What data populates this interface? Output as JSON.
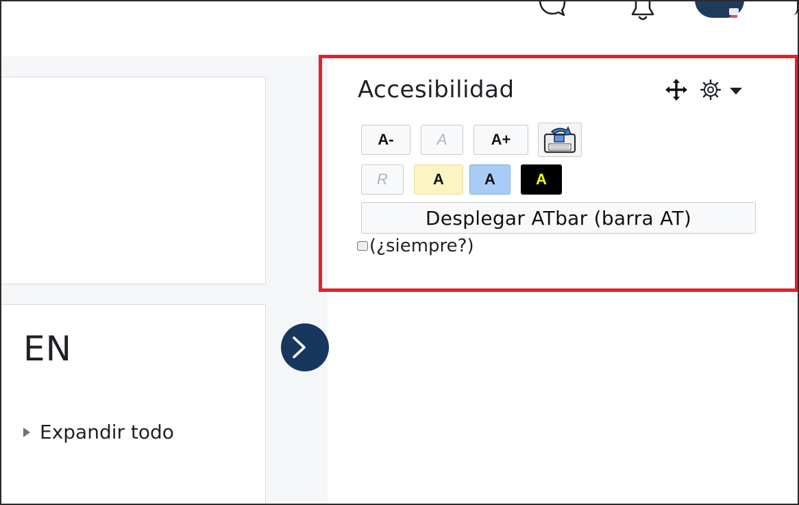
{
  "navbar": {
    "icons": [
      "message-icon",
      "bell-icon",
      "user-avatar",
      "overflow-icon"
    ]
  },
  "course": {
    "title": "EN",
    "expand_all_label": "Expandir todo"
  },
  "accessibility_block": {
    "title": "Accesibilidad",
    "controls": [
      "move-icon",
      "gear-icon",
      "caret-down-icon"
    ],
    "text_size_buttons": {
      "decrease": "A-",
      "reset": "A",
      "increase": "A+"
    },
    "save_icon": "save-settings-icon",
    "colour_buttons": {
      "reset": "R",
      "yellow": "A",
      "blue": "A",
      "black": "A"
    },
    "colour_values": {
      "yellow": "#fbf5c4",
      "blue": "#a8ccf5",
      "black": "#000000",
      "black_text": "#ffff00"
    },
    "launch_atbar_label": "Desplegar ATbar (barra AT)",
    "always_label": "(¿siempre?)",
    "always_checked": false
  },
  "colors": {
    "highlight_border": "#e5202a",
    "drawer_toggle": "#17375e",
    "page_background": "#f4f6f8"
  }
}
